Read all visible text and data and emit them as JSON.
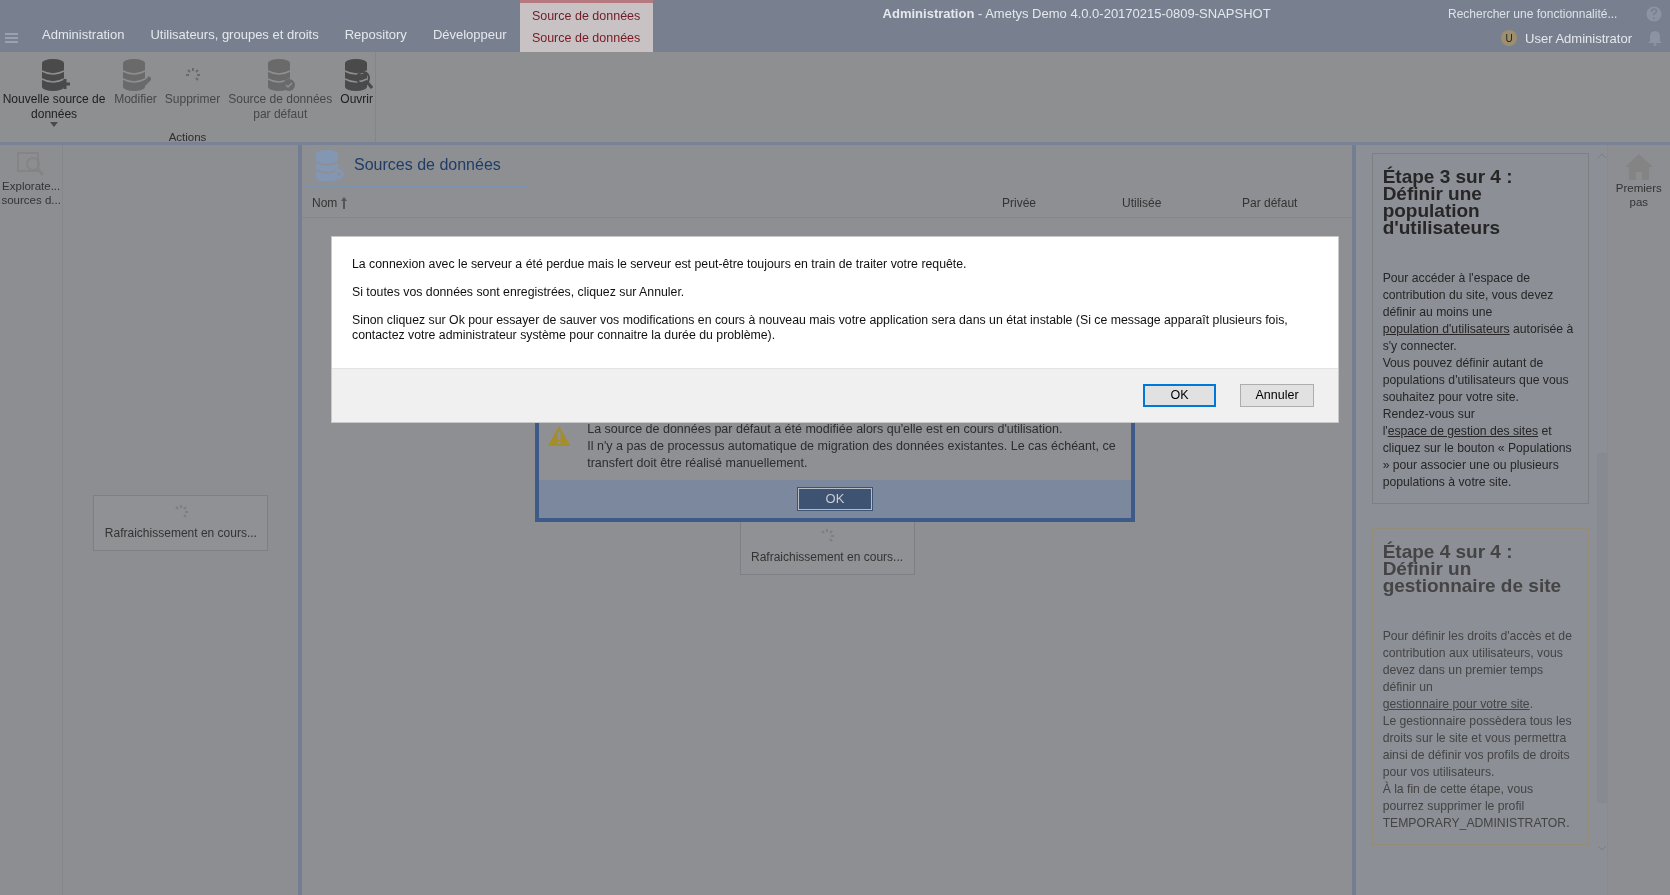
{
  "window": {
    "title": "**Administration** - Ametys Demo 4.0.0-20170215-0809-SNAPSHOT"
  },
  "menu_tabs": [
    {
      "label": "Administration",
      "selected": false
    },
    {
      "label": "Utilisateurs, groupes et droits",
      "selected": false
    },
    {
      "label": "Repository",
      "selected": false
    },
    {
      "label": "Développeur",
      "selected": false
    }
  ],
  "contextual_tab": {
    "group": "Source de données",
    "label": "Source de données",
    "selected": true
  },
  "search": {
    "placeholder": "Rechercher une fonctionnalité..."
  },
  "user": {
    "initial": "U",
    "name": "User Administrator"
  },
  "ribbon": {
    "group": "Actions",
    "buttons": [
      {
        "kind": "new",
        "label": "Nouvelle source de données",
        "has_menu": true,
        "disabled": false
      },
      {
        "kind": "edit",
        "label": "Modifier",
        "has_menu": false,
        "disabled": true
      },
      {
        "kind": "delete",
        "label": "Supprimer",
        "has_menu": false,
        "disabled": true
      },
      {
        "kind": "default",
        "label": "Source de données par défaut",
        "has_menu": false,
        "disabled": true
      },
      {
        "kind": "open",
        "label": "Ouvrir",
        "has_menu": false,
        "disabled": false
      }
    ]
  },
  "left_strip": {
    "lines": [
      "Explorate...",
      "sources d..."
    ]
  },
  "left_panel": {
    "loading": "Rafraichissement en cours..."
  },
  "center": {
    "tab": "Sources de données",
    "columns": [
      {
        "label": "Nom",
        "sorted": true
      },
      {
        "label": "Privée",
        "sorted": false
      },
      {
        "label": "Utilisée",
        "sorted": false
      },
      {
        "label": "Par défaut",
        "sorted": false
      }
    ],
    "loading": "Rafraichissement en cours..."
  },
  "warning_dialog": {
    "paragraphs": [
      "La source de données par défaut a été modifiée alors qu'elle est en cours d'utilisation.",
      "Il n'y a pas de processus automatique de migration des données existantes. Le cas échéant, ce transfert doit être réalisé manuellement."
    ],
    "button": "OK"
  },
  "connection_dialog": {
    "paragraphs": [
      "La connexion avec le serveur a été perdue mais le serveur est peut-être toujours en train de traiter votre requête.",
      "Si toutes vos données sont enregistrées, cliquez sur Annuler.",
      "Sinon cliquez sur Ok pour essayer de sauver vos modifications en cours à nouveau mais votre application sera dans un état instable (Si ce message apparaît plusieurs fois, contactez votre administrateur système pour connaitre la durée du problème)."
    ],
    "buttons": [
      {
        "label": "OK",
        "default": true
      },
      {
        "label": "Annuler",
        "default": false
      }
    ]
  },
  "help_panel": {
    "steps": [
      {
        "active": true,
        "title": "Étape 3 sur 4 : Définir une population d'utilisateurs",
        "paragraphs": [
          [
            {
              "text": "Pour accéder à l'espace de contribution du site, vous devez définir au moins une ",
              "link": false
            },
            {
              "text": "population d'utilisateurs",
              "link": true
            },
            {
              "text": " autorisée à s'y connecter.",
              "link": false
            }
          ],
          [
            {
              "text": "Vous pouvez définir autant de populations d'utilisateurs que vous souhaitez pour votre site.",
              "link": false
            }
          ],
          [
            {
              "text": "Rendez-vous sur l'",
              "link": false
            },
            {
              "text": "espace de gestion des sites",
              "link": true
            },
            {
              "text": " et cliquez sur le bouton « Populations » pour associer une ou plusieurs populations à votre site.",
              "link": false
            }
          ]
        ]
      },
      {
        "active": false,
        "title": "Étape 4 sur 4 : Définir un gestionnaire de site",
        "paragraphs": [
          [
            {
              "text": "Pour définir les droits d'accès et de contribution aux utilisateurs, vous devez dans un premier temps définir un ",
              "link": false
            },
            {
              "text": "gestionnaire pour votre site",
              "link": true
            },
            {
              "text": ".",
              "link": false
            }
          ],
          [
            {
              "text": "Le gestionnaire possèdera tous les droits sur le site et vous permettra ainsi de définir vos profils de droits pour vos utilisateurs.",
              "link": false
            }
          ],
          [
            {
              "text": "À la fin de cette étape, vous pourrez supprimer le profil TEMPORARY_ADMINISTRATOR.",
              "link": false
            }
          ]
        ]
      }
    ]
  },
  "right_strip": {
    "label": "Premiers pas"
  }
}
